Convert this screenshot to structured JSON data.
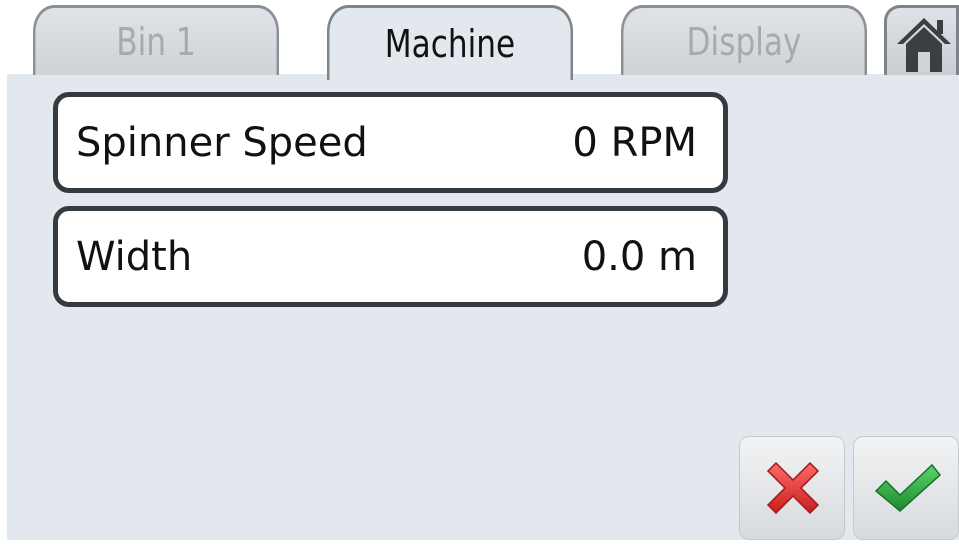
{
  "tabs": [
    {
      "label": "Bin 1",
      "active": false
    },
    {
      "label": "Machine",
      "active": true
    },
    {
      "label": "Display",
      "active": false
    }
  ],
  "home": {
    "icon": "home-icon"
  },
  "fields": [
    {
      "label": "Spinner Speed",
      "value": "0 RPM"
    },
    {
      "label": "Width",
      "value": "0.0 m"
    }
  ],
  "actions": {
    "cancel_icon": "red-x-icon",
    "confirm_icon": "green-check-icon"
  },
  "colors": {
    "panel_background": "#e3e8ef",
    "field_border": "#333a40",
    "cancel": "#e03030",
    "confirm": "#2e9a3a"
  }
}
